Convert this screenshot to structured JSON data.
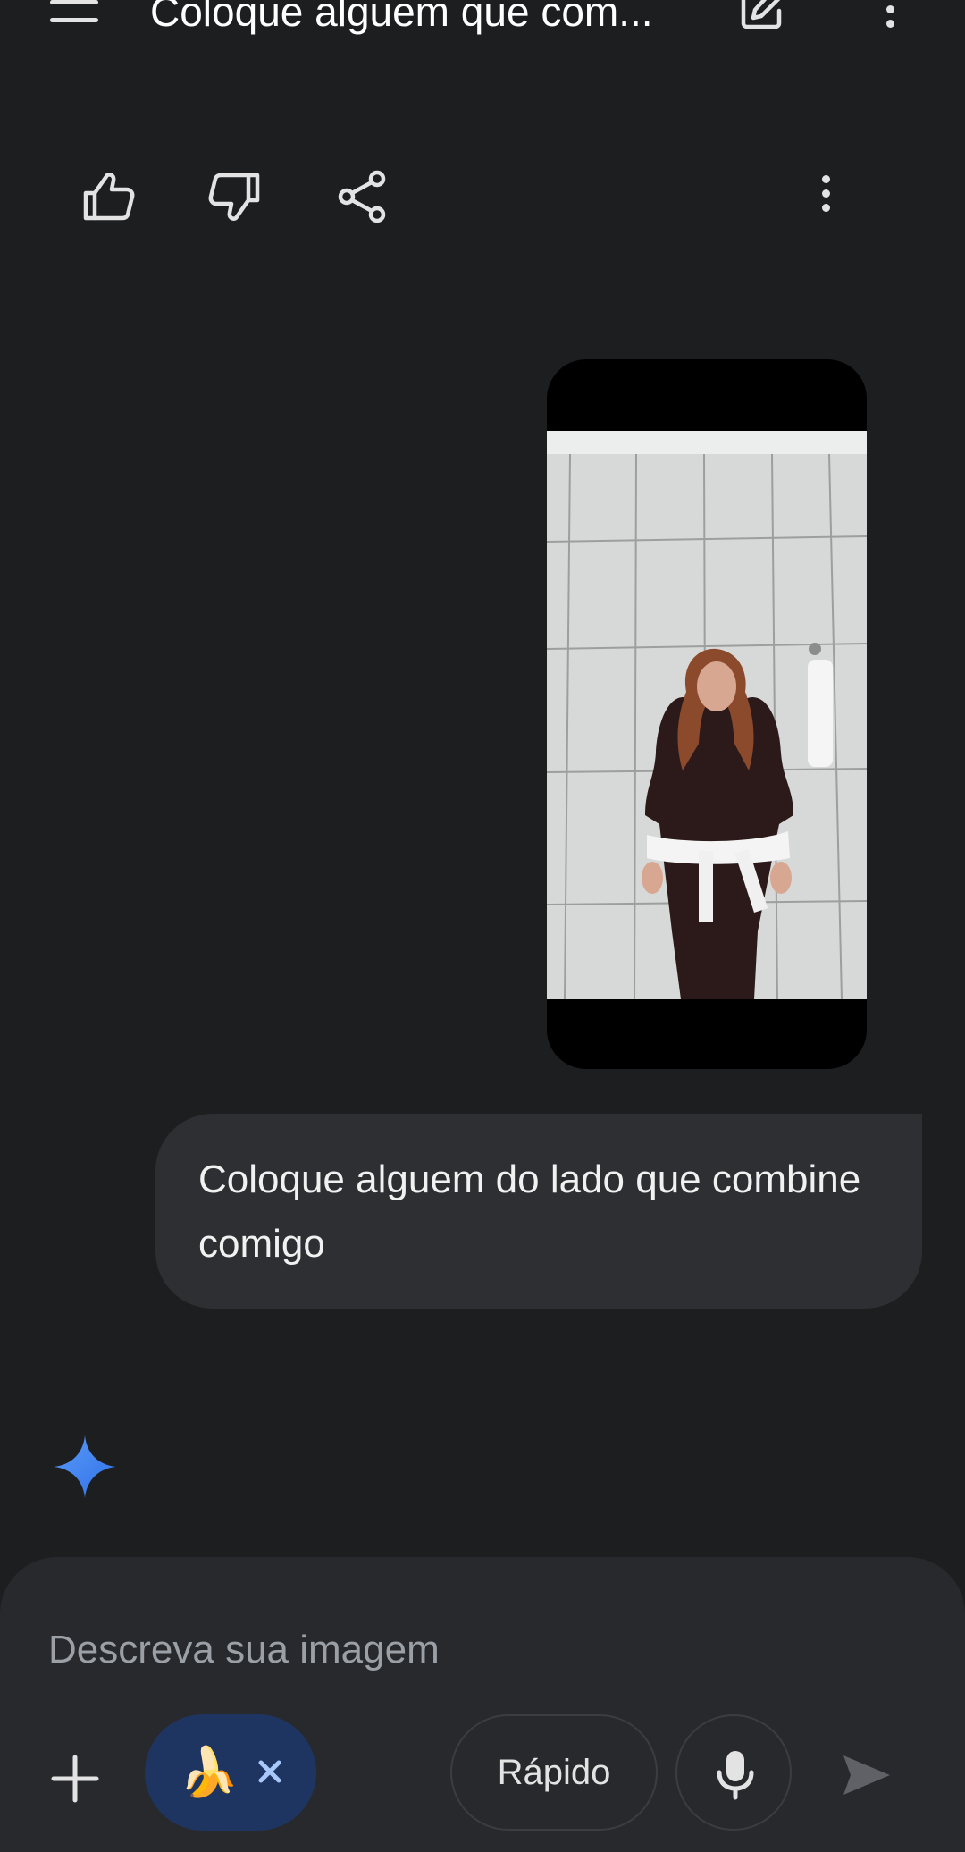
{
  "header": {
    "title": "Coloque alguem que com...",
    "menu_icon": "menu-icon",
    "edit_icon": "edit-icon",
    "more_icon": "more-vert-icon"
  },
  "response_actions": {
    "like_icon": "thumb-up-icon",
    "dislike_icon": "thumb-down-icon",
    "share_icon": "share-icon",
    "more_icon": "more-vert-icon"
  },
  "conversation": {
    "user_message": "Coloque alguem do lado que combine comigo",
    "assistant_icon": "gemini-sparkle-icon"
  },
  "composer": {
    "placeholder": "Descreva sua imagem",
    "tool_chip_emoji": "🍌",
    "mode_label": "Rápido"
  },
  "colors": {
    "background": "#1d1e20",
    "bubble": "#2e2f32",
    "composer": "#28292c",
    "chip": "#1f3561",
    "sparkle": "#4b8df8",
    "chip_close": "#a8c7fa"
  }
}
